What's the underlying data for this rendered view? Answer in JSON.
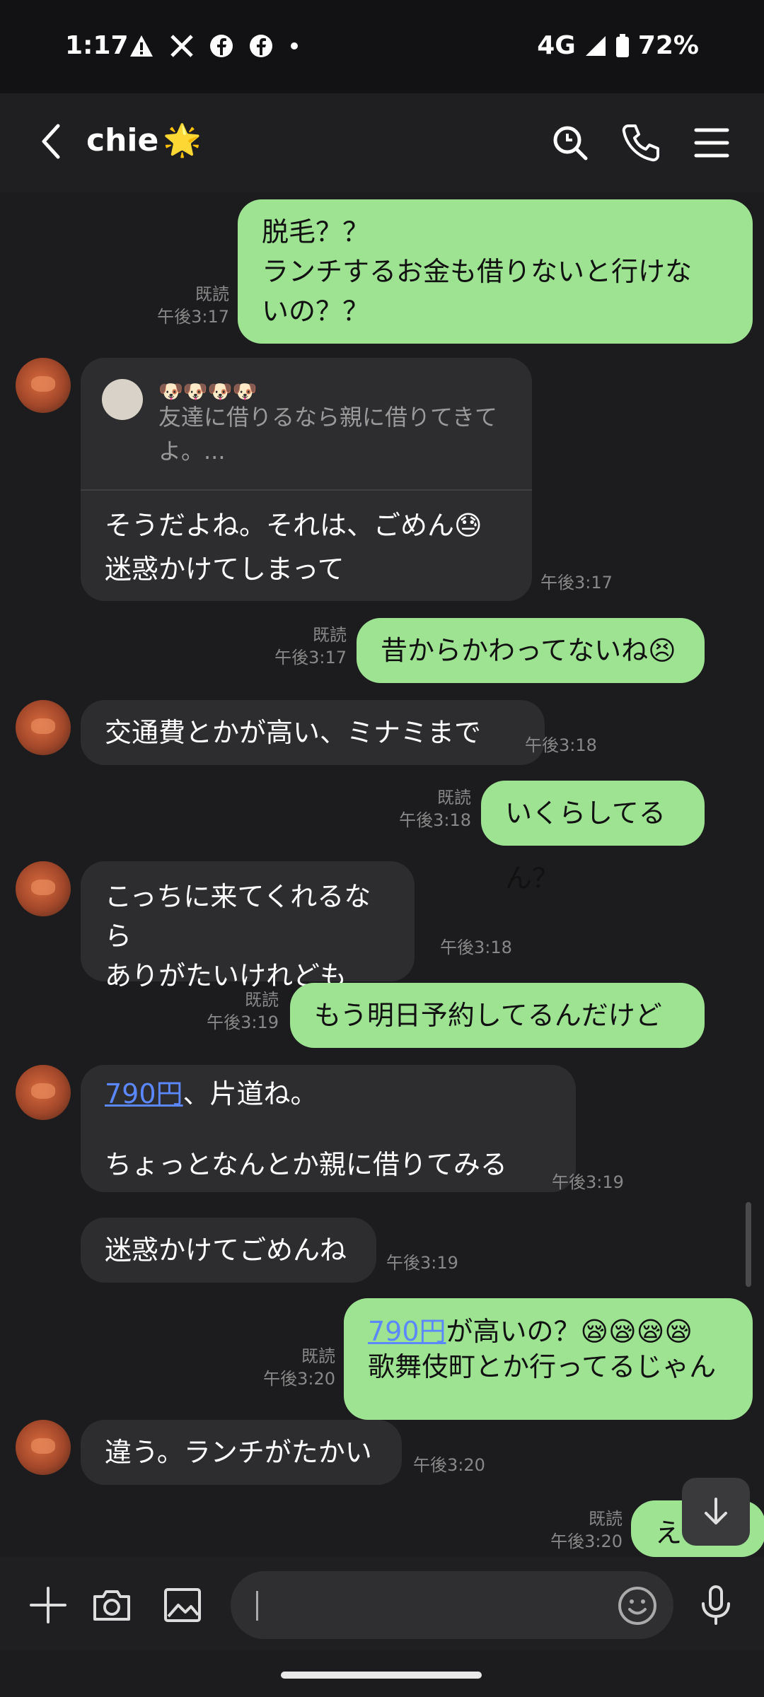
{
  "status_bar": {
    "time": "1:17",
    "notification_icons": [
      "alert-icon",
      "x-icon",
      "facebook-icon",
      "facebook-icon",
      "dot-icon"
    ],
    "network": "4G",
    "battery": "72%"
  },
  "header": {
    "title": "chie",
    "title_emoji": "🌟"
  },
  "messages": [
    {
      "id": "m1",
      "dir": "out",
      "read": "既読",
      "time": "午後3:17",
      "text": "脱毛？？\nランチするお金も借りないと行けな\nいの？？"
    },
    {
      "id": "m2",
      "dir": "in",
      "time": "午後3:17",
      "quote_emoji": "🐶🐶🐶🐶",
      "quote_text": "友達に借りるなら親に借りてきて\nよ。...",
      "text": "そうだよね。それは、ごめん😓\n迷惑かけてしまって"
    },
    {
      "id": "m3",
      "dir": "out",
      "read": "既読",
      "time": "午後3:17",
      "text": "昔からかわってないね😣😣"
    },
    {
      "id": "m4",
      "dir": "in",
      "time": "午後3:18",
      "text": "交通費とかが高い、ミナミまで"
    },
    {
      "id": "m5",
      "dir": "out",
      "read": "既読",
      "time": "午後3:18",
      "text": "いくらしてるん？"
    },
    {
      "id": "m6",
      "dir": "in",
      "time": "午後3:18",
      "text": "こっちに来てくれるなら\nありがたいけれども"
    },
    {
      "id": "m7",
      "dir": "out",
      "read": "既読",
      "time": "午後3:19",
      "text": "もう明日予約してるんだけども、"
    },
    {
      "id": "m8",
      "dir": "in",
      "time": "午後3:19",
      "link": "790円",
      "text_after_link": "、片道ね。\n\nちょっとなんとか親に借りてみる"
    },
    {
      "id": "m9",
      "dir": "in",
      "time": "午後3:19",
      "text": "迷惑かけてごめんね"
    },
    {
      "id": "m10",
      "dir": "out",
      "read": "既読",
      "time": "午後3:20",
      "link": "790円",
      "text_after_link": "が高いの？😪😪😪😪\n歌舞伎町とか行ってるじゃん"
    },
    {
      "id": "m11",
      "dir": "in",
      "time": "午後3:20",
      "text": "違う。ランチがたかい"
    },
    {
      "id": "m12",
      "dir": "out",
      "read": "既読",
      "time": "午後3:20",
      "text": "え"
    }
  ],
  "input": {
    "placeholder": ""
  },
  "colors": {
    "outgoing_bubble": "#9de392",
    "incoming_bubble": "#2d2d2f",
    "background": "#1c1c1e",
    "link": "#5b87ff"
  }
}
